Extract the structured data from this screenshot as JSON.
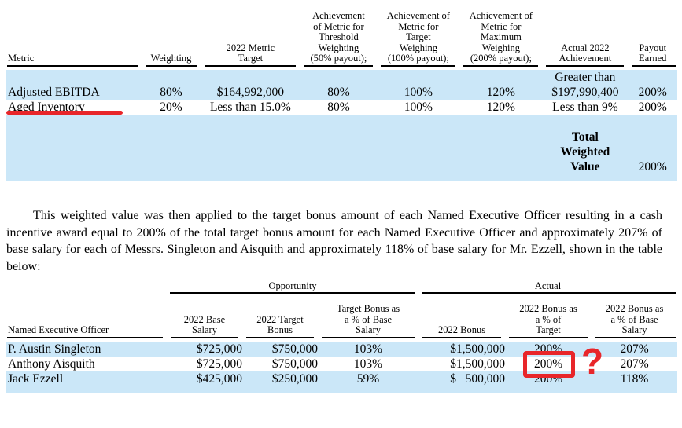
{
  "metrics_table": {
    "headers": {
      "metric": "Metric",
      "weighting": "Weighting",
      "metric_target": "2022 Metric\nTarget",
      "threshold": "Achievement\nof Metric for\nThreshold\nWeighting\n(50% payout);",
      "target": "Achievement of\nMetric for\nTarget\nWeighing\n(100% payout);",
      "maximum": "Achievement of\nMetric for\nMaximum\nWeighing\n(200% payout);",
      "actual": "Actual 2022\nAchievement",
      "payout": "Payout\nEarned"
    },
    "rows": [
      {
        "metric": "Adjusted EBITDA",
        "weighting": "80%",
        "metric_target": "$164,992,000",
        "threshold": "80%",
        "target": "100%",
        "maximum": "120%",
        "actual_line1": "Greater than",
        "actual_line2": "$197,990,400",
        "payout": "200%"
      },
      {
        "metric": "Aged Inventory",
        "weighting": "20%",
        "metric_target": "Less than 15.0%",
        "threshold": "80%",
        "target": "100%",
        "maximum": "120%",
        "actual_line1": "",
        "actual_line2": "Less than 9%",
        "payout": "200%"
      }
    ],
    "total": {
      "label_line1": "Total",
      "label_line2": "Weighted",
      "label_line3": "Value",
      "value": "200%"
    }
  },
  "paragraph": {
    "text": "This weighted value was then applied to the target bonus amount of each Named Executive Officer resulting in a cash incentive award equal to 200% of the total target bonus amount for each Named Executive Officer and approximately 207% of base salary for each of Messrs. Singleton and Aisquith and approximately 118% of base salary for Mr. Ezzell, shown in the table below:"
  },
  "bonus_table": {
    "spanners": {
      "opportunity": "Opportunity",
      "actual": "Actual"
    },
    "headers": {
      "officer": "Named Executive Officer",
      "base_salary": "2022 Base\nSalary",
      "target_bonus": "2022 Target\nBonus",
      "target_bonus_pct": "Target Bonus as\na % of Base\nSalary",
      "bonus": "2022 Bonus",
      "bonus_pct_target": "2022 Bonus as\na % of\nTarget",
      "bonus_pct_salary": "2022 Bonus as\na % of Base\nSalary"
    },
    "rows": [
      {
        "officer": "P. Austin Singleton",
        "base_salary": "$725,000",
        "target_bonus": "$750,000",
        "target_bonus_pct": "103%",
        "bonus": "$1,500,000",
        "bonus_pct_target": "200%",
        "bonus_pct_salary": "207%"
      },
      {
        "officer": "Anthony Aisquith",
        "base_salary": "$725,000",
        "target_bonus": "$750,000",
        "target_bonus_pct": "103%",
        "bonus": "$1,500,000",
        "bonus_pct_target": "200%",
        "bonus_pct_salary": "207%"
      },
      {
        "officer": "Jack Ezzell",
        "base_salary": "$425,000",
        "target_bonus": "$250,000",
        "target_bonus_pct": "59%",
        "bonus": "$   500,000",
        "bonus_pct_target": "200%",
        "bonus_pct_salary": "118%"
      }
    ]
  },
  "annotations": {
    "color": "#e8262a",
    "question_mark": "?",
    "underline_target": "Adjusted EBITDA",
    "highlight_target": "200%"
  }
}
